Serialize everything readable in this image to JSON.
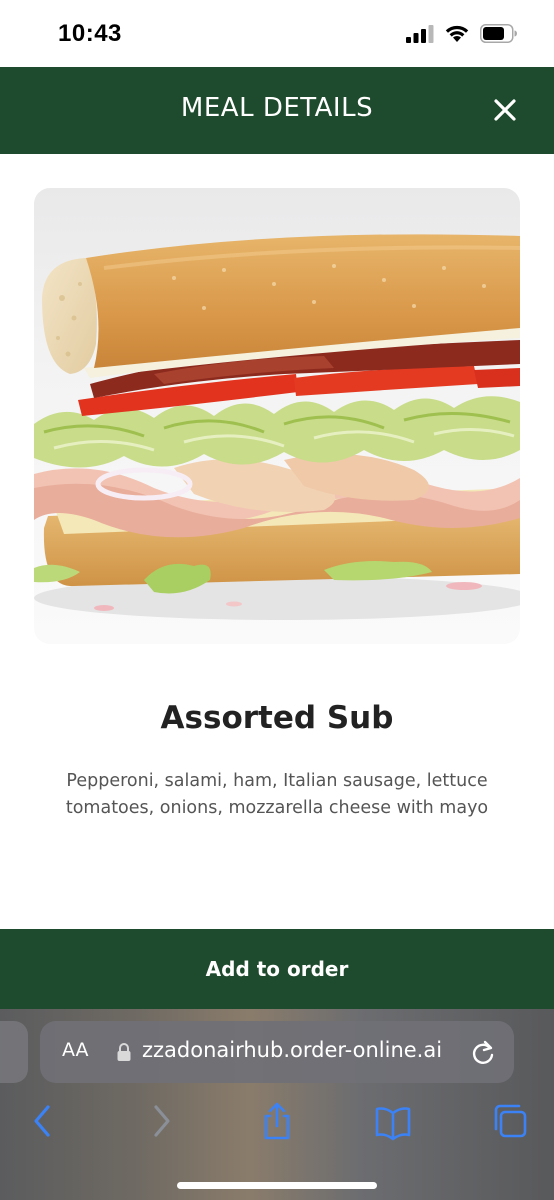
{
  "status_bar": {
    "time": "10:43"
  },
  "header": {
    "title": "MEAL DETAILS",
    "background": "#1e4b2d",
    "close_icon": "close-icon"
  },
  "product": {
    "image_icon": "sandwich-image",
    "name": "Assorted Sub",
    "description_line1": "Pepperoni, salami, ham, Italian sausage, lettuce",
    "description_line2": "tomatoes, onions, mozzarella cheese with mayo"
  },
  "actions": {
    "add_to_order_label": "Add to order"
  },
  "browser": {
    "text_size_label": "AA",
    "url": "zzadonairhub.order-online.ai",
    "icons": [
      "lock-icon",
      "reload-icon",
      "back-icon",
      "forward-icon",
      "share-icon",
      "bookmarks-icon",
      "tabs-icon"
    ],
    "accent": "#3b82f6"
  }
}
